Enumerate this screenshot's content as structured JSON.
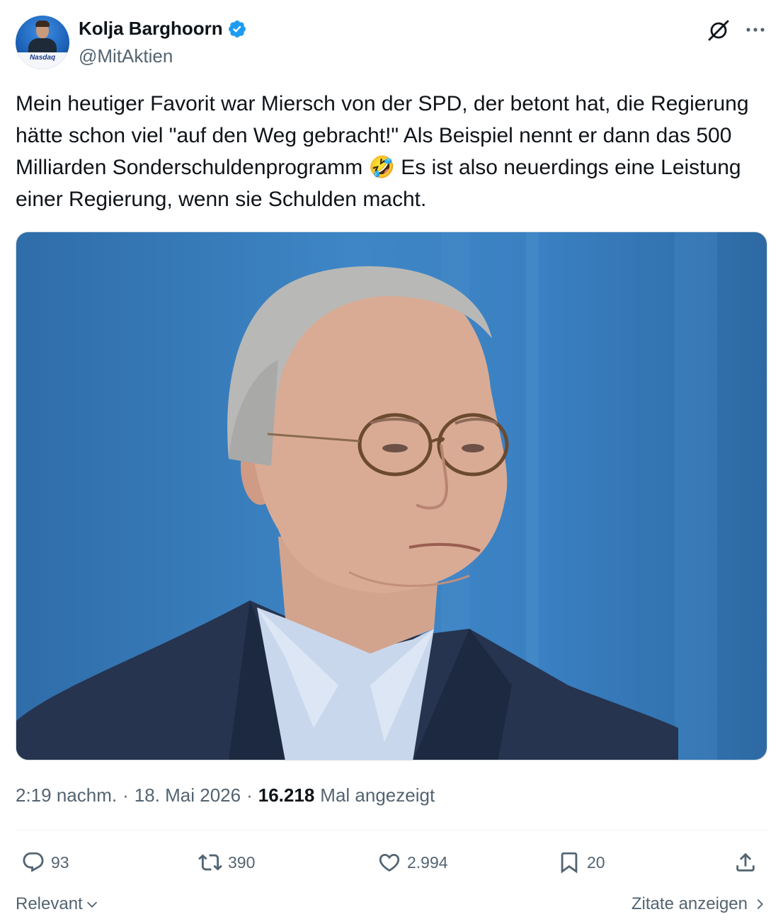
{
  "author": {
    "display_name": "Kolja Barghoorn",
    "handle": "@MitAktien",
    "verified": true,
    "avatar_label": "Nasdaq"
  },
  "tweet": {
    "text": "Mein heutiger Favorit war Miersch von der SPD, der betont hat, die Regierung hätte schon viel \"auf den Weg gebracht!\" Als Beispiel nennt er dann das 500 Milliarden Sonderschuldenprogramm 🤣 Es ist also neuerdings eine Leistung einer Regierung, wenn sie Schulden macht."
  },
  "meta": {
    "time": "2:19 nachm.",
    "separator": "·",
    "date": "18. Mai 2026",
    "views": "16.218",
    "views_label": "Mal angezeigt"
  },
  "actions": {
    "replies": "93",
    "reposts": "390",
    "likes": "2.994",
    "bookmarks": "20"
  },
  "footer": {
    "sort_label": "Relevant",
    "quotes_label": "Zitate anzeigen"
  },
  "colors": {
    "verified": "#1d9bf0",
    "secondary_text": "#536471",
    "primary_text": "#0f1419"
  },
  "icons": [
    "verified-badge-icon",
    "grok-icon",
    "more-icon",
    "reply-icon",
    "repost-icon",
    "like-icon",
    "bookmark-icon",
    "share-icon",
    "chevron-down-icon",
    "chevron-right-icon"
  ]
}
